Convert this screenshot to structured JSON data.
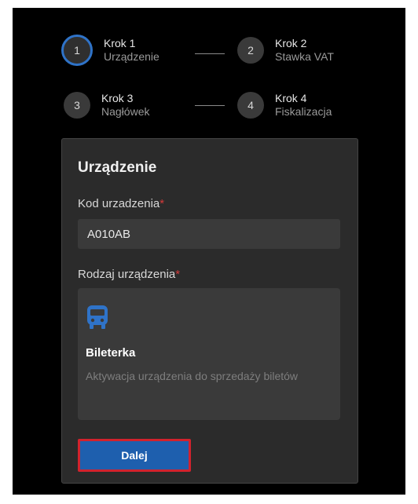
{
  "stepper": {
    "steps": [
      {
        "number": "1",
        "title": "Krok 1",
        "subtitle": "Urządzenie",
        "active": true
      },
      {
        "number": "2",
        "title": "Krok 2",
        "subtitle": "Stawka VAT",
        "active": false
      },
      {
        "number": "3",
        "title": "Krok 3",
        "subtitle": "Nagłówek",
        "active": false
      },
      {
        "number": "4",
        "title": "Krok 4",
        "subtitle": "Fiskalizacja",
        "active": false
      }
    ]
  },
  "form": {
    "title": "Urządzenie",
    "device_code_label": "Kod urzadzenia",
    "device_code_value": "A010AB",
    "device_type_label": "Rodzaj urządzenia",
    "required_mark": "*",
    "option": {
      "icon": "bus-icon",
      "name": "Bileterka",
      "description": "Aktywacja urządzenia do sprzedaży biletów"
    },
    "next_label": "Dalej"
  },
  "colors": {
    "accent": "#2f73c8",
    "button": "#1e5fae",
    "required": "#d33a3a",
    "highlight_border": "#d2222d"
  }
}
